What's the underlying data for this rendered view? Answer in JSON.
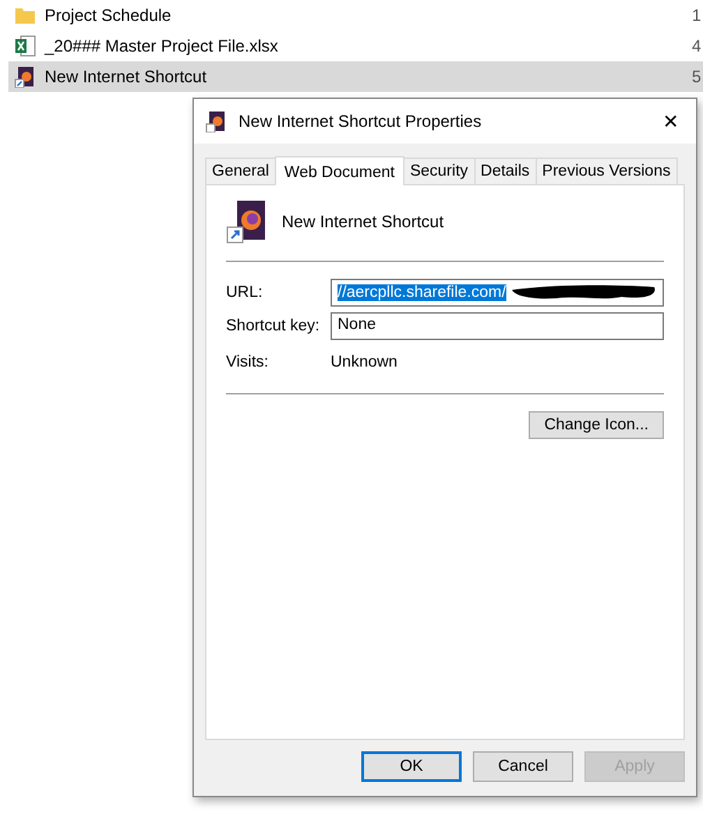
{
  "explorer": {
    "rows": [
      {
        "kind": "folder",
        "name": "Project Schedule",
        "column_2": "1",
        "selected": false
      },
      {
        "kind": "excel",
        "name": "_20### Master Project File.xlsx",
        "column_2": "4",
        "selected": false
      },
      {
        "kind": "shortcut",
        "name": "New Internet Shortcut",
        "column_2": "5",
        "selected": true
      }
    ]
  },
  "dialog": {
    "title": "New Internet Shortcut Properties",
    "close": "✕",
    "tabs": [
      {
        "label": "General",
        "selected": false
      },
      {
        "label": "Web Document",
        "selected": true
      },
      {
        "label": "Security",
        "selected": false
      },
      {
        "label": "Details",
        "selected": false
      },
      {
        "label": "Previous Versions",
        "selected": false
      }
    ],
    "name": "New Internet Shortcut",
    "url": {
      "label": "URL:",
      "value": "//aercpllc.sharefile.com/",
      "redacted": true
    },
    "shortcut_key": {
      "label": "Shortcut key:",
      "value": "None"
    },
    "visits": {
      "label": "Visits:",
      "value": "Unknown"
    },
    "change_icon": "Change Icon...",
    "buttons": [
      {
        "label": "OK",
        "kind": "default",
        "disabled": false
      },
      {
        "label": "Cancel",
        "kind": "normal",
        "disabled": false
      },
      {
        "label": "Apply",
        "kind": "normal",
        "disabled": true
      }
    ]
  }
}
